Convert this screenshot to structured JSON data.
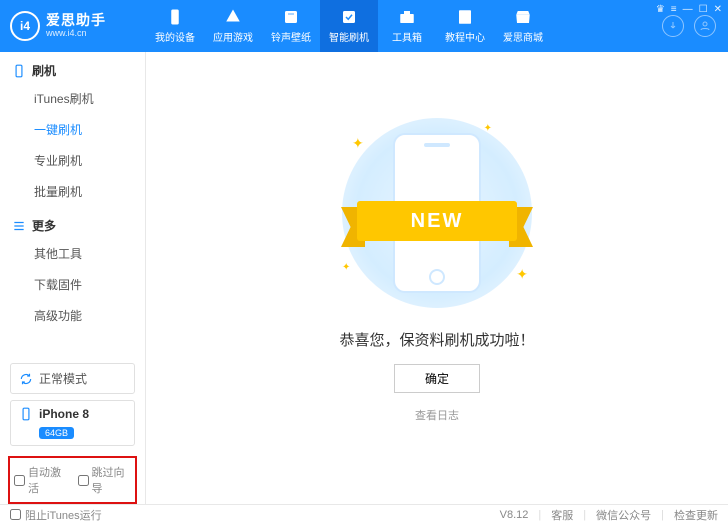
{
  "brand": {
    "logo_text": "i4",
    "name": "爱思助手",
    "url": "www.i4.cn"
  },
  "nav": [
    {
      "label": "我的设备"
    },
    {
      "label": "应用游戏"
    },
    {
      "label": "铃声壁纸"
    },
    {
      "label": "智能刷机",
      "active": true
    },
    {
      "label": "工具箱"
    },
    {
      "label": "教程中心"
    },
    {
      "label": "爱思商城"
    }
  ],
  "sidebar": {
    "section_flash": "刷机",
    "flash_items": [
      {
        "label": "iTunes刷机"
      },
      {
        "label": "一键刷机",
        "active": true
      },
      {
        "label": "专业刷机"
      },
      {
        "label": "批量刷机"
      }
    ],
    "section_more": "更多",
    "more_items": [
      {
        "label": "其他工具"
      },
      {
        "label": "下载固件"
      },
      {
        "label": "高级功能"
      }
    ],
    "mode": "正常模式",
    "device": "iPhone 8",
    "storage": "64GB",
    "opt_auto_activate": "自动激活",
    "opt_skip_guide": "跳过向导"
  },
  "main": {
    "ribbon": "NEW",
    "success": "恭喜您，保资料刷机成功啦！",
    "ok": "确定",
    "log": "查看日志"
  },
  "footer": {
    "block_itunes": "阻止iTunes运行",
    "version": "V8.12",
    "support": "客服",
    "wechat": "微信公众号",
    "update": "检查更新"
  }
}
